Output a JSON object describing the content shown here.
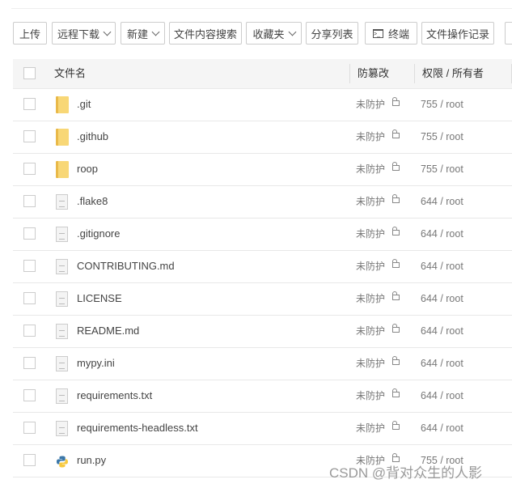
{
  "toolbar": {
    "upload": "上传",
    "remote_download": "远程下载",
    "new": "新建",
    "content_search": "文件内容搜索",
    "favorites": "收藏夹",
    "share_list": "分享列表",
    "terminal": "终端",
    "op_log": "文件操作记录"
  },
  "table": {
    "headers": {
      "name": "文件名",
      "tamper": "防篡改",
      "perm": "权限 / 所有者"
    },
    "rows": [
      {
        "name": ".git",
        "type": "folder",
        "tamper": "未防护",
        "perm": "755 / root"
      },
      {
        "name": ".github",
        "type": "folder",
        "tamper": "未防护",
        "perm": "755 / root"
      },
      {
        "name": "roop",
        "type": "folder",
        "tamper": "未防护",
        "perm": "755 / root"
      },
      {
        "name": ".flake8",
        "type": "file",
        "tamper": "未防护",
        "perm": "644 / root"
      },
      {
        "name": ".gitignore",
        "type": "file",
        "tamper": "未防护",
        "perm": "644 / root"
      },
      {
        "name": "CONTRIBUTING.md",
        "type": "file",
        "tamper": "未防护",
        "perm": "644 / root"
      },
      {
        "name": "LICENSE",
        "type": "file",
        "tamper": "未防护",
        "perm": "644 / root"
      },
      {
        "name": "README.md",
        "type": "file",
        "tamper": "未防护",
        "perm": "644 / root"
      },
      {
        "name": "mypy.ini",
        "type": "file",
        "tamper": "未防护",
        "perm": "644 / root"
      },
      {
        "name": "requirements.txt",
        "type": "file",
        "tamper": "未防护",
        "perm": "644 / root"
      },
      {
        "name": "requirements-headless.txt",
        "type": "file",
        "tamper": "未防护",
        "perm": "644 / root"
      },
      {
        "name": "run.py",
        "type": "python",
        "tamper": "未防护",
        "perm": "755 / root"
      }
    ]
  },
  "watermark": "CSDN @背对众生的人影"
}
